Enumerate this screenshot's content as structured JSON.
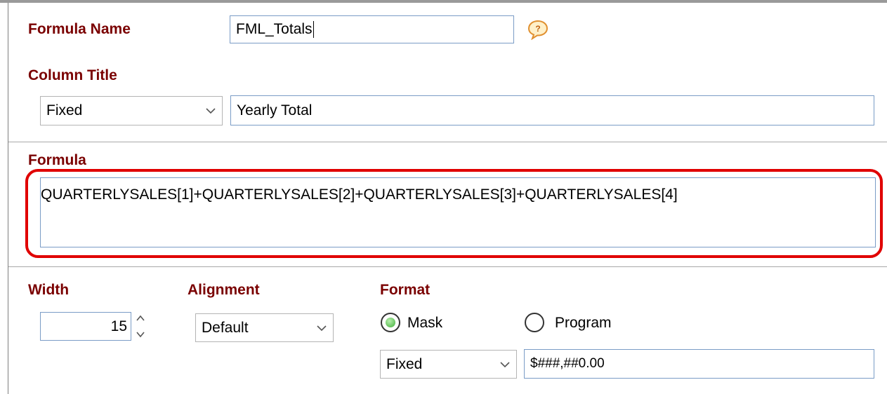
{
  "formula_name": {
    "label": "Formula Name",
    "value": "FML_Totals",
    "help_icon": "speech-bubble-question-icon"
  },
  "column_title": {
    "label": "Column Title",
    "type_value": "Fixed",
    "title_value": "Yearly Total"
  },
  "formula": {
    "label": "Formula",
    "value": "QUARTERLYSALES[1]+QUARTERLYSALES[2]+QUARTERLYSALES[3]+QUARTERLYSALES[4]",
    "highlight_color": "#e00000"
  },
  "width": {
    "label": "Width",
    "value": "15"
  },
  "alignment": {
    "label": "Alignment",
    "value": "Default"
  },
  "format": {
    "label": "Format",
    "options": [
      {
        "label": "Mask",
        "selected": true
      },
      {
        "label": "Program",
        "selected": false
      }
    ],
    "type_value": "Fixed",
    "mask_value": "$###,##0.00"
  },
  "colors": {
    "label": "#7a0000",
    "input_border": "#7a9cc6",
    "radio_selected": "#3fae37"
  }
}
